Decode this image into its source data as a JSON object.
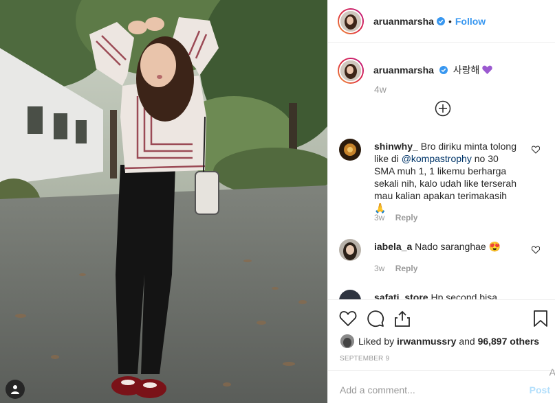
{
  "post": {
    "username": "aruanmarsha",
    "follow_label": "Follow",
    "dot": "•",
    "caption_text": "사랑해",
    "caption_time": "4w",
    "likes_prefix": "Liked by",
    "likes_user": "irwanmussry",
    "likes_and": "and",
    "likes_count": "96,897 others",
    "date": "SEPTEMBER 9",
    "comment_placeholder": "Add a comment...",
    "post_label": "Post",
    "edge_char": "A"
  },
  "comments": [
    {
      "username": "shinwhy_",
      "text_before": "Bro diriku minta tolong like di",
      "mention": "@kompastrophy",
      "text_after": "no 30 SMA muh 1, 1 likemu berharga sekali nih, kalo udah like terserah mau kalian apakan terimakasih🙏",
      "time": "3w",
      "reply": "Reply"
    },
    {
      "username": "iabela_a",
      "text_before": "Nado saranghae",
      "mention": "",
      "text_after": "😍",
      "time": "3w",
      "reply": "Reply"
    },
    {
      "username": "safati_store",
      "text_before": "Hp second bisa",
      "mention": "",
      "text_after": "",
      "time": "",
      "reply": ""
    }
  ],
  "icons": {
    "verified": "verified-badge-icon",
    "heart": "heart-icon",
    "comment": "comment-icon",
    "share": "share-icon",
    "save": "bookmark-icon",
    "load_more": "plus-circle-icon",
    "user_tag": "person-icon"
  },
  "colors": {
    "link_blue": "#3897f0",
    "muted": "#999999",
    "text": "#262626",
    "post_disabled": "#b2dffc"
  }
}
